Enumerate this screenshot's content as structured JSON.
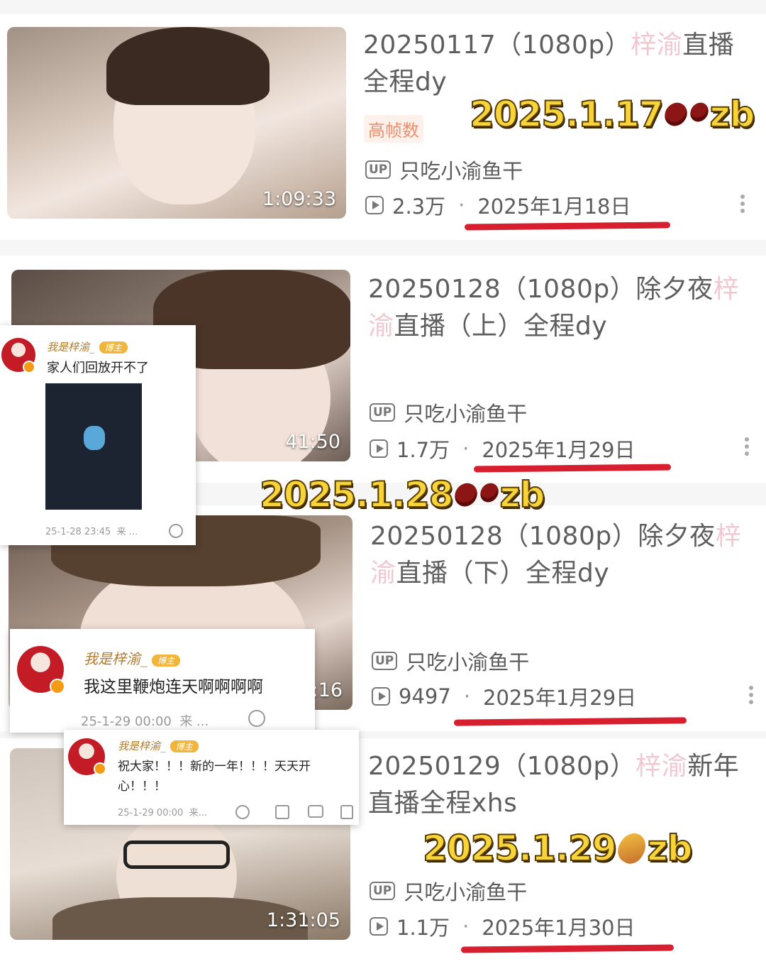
{
  "videos": [
    {
      "title_pre": "20250117（1080p）",
      "title_hl": "梓渝",
      "title_post": "直播全程dy",
      "tag": "高帧数",
      "uploader": "只吃小渝鱼干",
      "views": "2.3万",
      "date": "2025年1月18日",
      "duration": "1:09:33"
    },
    {
      "title_pre": "20250128（1080p）除夕夜",
      "title_hl": "梓渝",
      "title_post": "直播（上）全程dy",
      "uploader": "只吃小渝鱼干",
      "views": "1.7万",
      "date": "2025年1月29日",
      "duration": "41:50"
    },
    {
      "title_pre": "20250128（1080p）除夕夜",
      "title_hl": "梓渝",
      "title_post": "直播（下）全程dy",
      "uploader": "只吃小渝鱼干",
      "views": "9497",
      "date": "2025年1月29日",
      "duration": ":16"
    },
    {
      "title_pre": "20250129（1080p）",
      "title_hl": "梓渝",
      "title_post": "新年直播全程xhs",
      "uploader": "只吃小渝鱼干",
      "views": "1.1万",
      "date": "2025年1月30日",
      "duration": "1:31:05"
    }
  ],
  "labels": {
    "up": "UP"
  },
  "stamps": [
    {
      "date": "2025.1.17",
      "suffix": "zb",
      "icon": "red-bean"
    },
    {
      "date": "2025.1.28",
      "suffix": "zb",
      "icon": "red-bean"
    },
    {
      "date": "2025.1.29",
      "suffix": "zb",
      "icon": "sweet-potato"
    }
  ],
  "comments": [
    {
      "name": "我是梓渝_",
      "badge": "博主",
      "text": "家人们回放开不了",
      "time": "25-1-28 23:45",
      "source": "来 ..."
    },
    {
      "name": "我是梓渝_",
      "badge": "博主",
      "text": "我这里鞭炮连天啊啊啊啊",
      "time": "25-1-29 00:00",
      "source": "来 ..."
    },
    {
      "name": "我是梓渝_",
      "badge": "博主",
      "text": "祝大家！！！新的一年！！！天天开心！！！",
      "time": "25-1-29 00:00",
      "source": "来..."
    }
  ],
  "colors": {
    "underline": "#d81f2f",
    "stamp": "#f7d43a",
    "tag": "#f08e6c",
    "title_highlight": "#f1c8cf"
  }
}
